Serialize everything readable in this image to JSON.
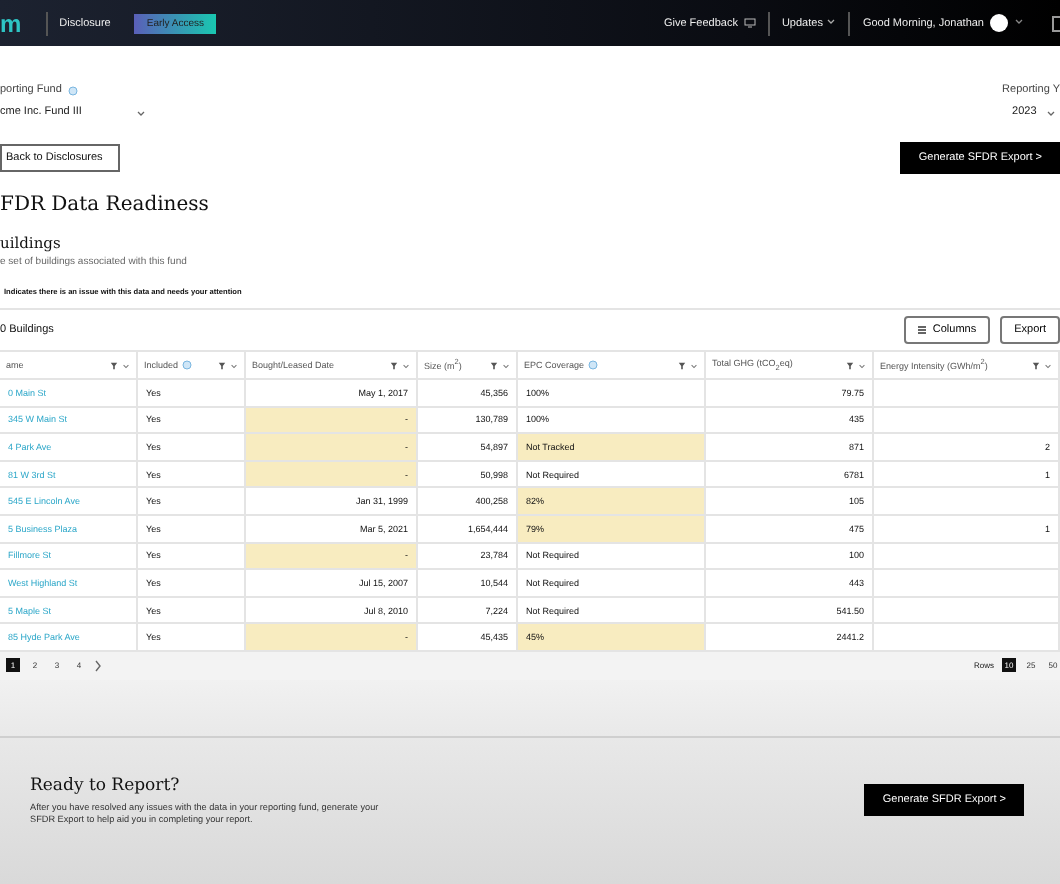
{
  "topbar": {
    "logo": "m",
    "section": "Disclosure",
    "badge": "Early Access",
    "feedback": "Give Feedback",
    "updates": "Updates",
    "greeting": "Good Morning, Jonathan"
  },
  "filters": {
    "fund_label": "porting Fund",
    "fund_value": "cme Inc. Fund III",
    "year_label": "Reporting Y",
    "year_value": "2023"
  },
  "back_button": "Back to Disclosures",
  "export_button": "Generate SFDR Export >",
  "title": "FDR Data Readiness",
  "section_title": "uildings",
  "section_subtitle": "e set of buildings associated with this fund",
  "notice": "Indicates there is an issue with this data and needs your attention",
  "table": {
    "count": "0 Buildings",
    "columns_button": "Columns",
    "export_button": "Export",
    "columns": [
      {
        "label": "ame",
        "info": false,
        "kind": "text"
      },
      {
        "label": "Included",
        "info": true,
        "kind": "text"
      },
      {
        "label": "Bought/Leased Date",
        "info": false,
        "kind": "number"
      },
      {
        "label": "Size (m$^{2}$)",
        "info": false,
        "kind": "number"
      },
      {
        "label": "EPC Coverage",
        "info": true,
        "kind": "text"
      },
      {
        "label": "Total GHG (tCO$_{2}$eq)",
        "info": false,
        "kind": "number"
      },
      {
        "label": "Energy Intensity (GWh/m$^{2}$)",
        "info": false,
        "kind": "number"
      }
    ],
    "rows": [
      {
        "cells": [
          {
            "text": "0 Main St",
            "flagged": false
          },
          {
            "text": "Yes",
            "flagged": false
          },
          {
            "text": "May 1, 2017",
            "flagged": false
          },
          {
            "text": "45,356",
            "flagged": false
          },
          {
            "text": "100%",
            "flagged": false
          },
          {
            "text": "79.75",
            "flagged": false
          },
          {
            "text": "",
            "flagged": false
          }
        ]
      },
      {
        "cells": [
          {
            "text": "345 W Main St",
            "flagged": false
          },
          {
            "text": "Yes",
            "flagged": false
          },
          {
            "text": "-",
            "flagged": true
          },
          {
            "text": "130,789",
            "flagged": false
          },
          {
            "text": "100%",
            "flagged": false
          },
          {
            "text": "435",
            "flagged": false
          },
          {
            "text": "",
            "flagged": false
          }
        ]
      },
      {
        "cells": [
          {
            "text": "4 Park Ave",
            "flagged": false
          },
          {
            "text": "Yes",
            "flagged": false
          },
          {
            "text": "-",
            "flagged": true
          },
          {
            "text": "54,897",
            "flagged": false
          },
          {
            "text": "Not Tracked",
            "flagged": true
          },
          {
            "text": "871",
            "flagged": false
          },
          {
            "text": "2",
            "flagged": false
          }
        ]
      },
      {
        "cells": [
          {
            "text": "81 W 3rd St",
            "flagged": false
          },
          {
            "text": "Yes",
            "flagged": false
          },
          {
            "text": "-",
            "flagged": true
          },
          {
            "text": "50,998",
            "flagged": false
          },
          {
            "text": "Not Required",
            "flagged": false
          },
          {
            "text": "6781",
            "flagged": false
          },
          {
            "text": "1",
            "flagged": false
          }
        ]
      },
      {
        "cells": [
          {
            "text": "545 E Lincoln Ave",
            "flagged": false
          },
          {
            "text": "Yes",
            "flagged": false
          },
          {
            "text": "Jan 31, 1999",
            "flagged": false
          },
          {
            "text": "400,258",
            "flagged": false
          },
          {
            "text": "82%",
            "flagged": true
          },
          {
            "text": "105",
            "flagged": false
          },
          {
            "text": "",
            "flagged": false
          }
        ]
      },
      {
        "cells": [
          {
            "text": "5 Business Plaza",
            "flagged": false
          },
          {
            "text": "Yes",
            "flagged": false
          },
          {
            "text": "Mar 5, 2021",
            "flagged": false
          },
          {
            "text": "1,654,444",
            "flagged": false
          },
          {
            "text": "79%",
            "flagged": true
          },
          {
            "text": "475",
            "flagged": false
          },
          {
            "text": "1",
            "flagged": false
          }
        ]
      },
      {
        "cells": [
          {
            "text": "Fillmore St",
            "flagged": false
          },
          {
            "text": "Yes",
            "flagged": false
          },
          {
            "text": "-",
            "flagged": true
          },
          {
            "text": "23,784",
            "flagged": false
          },
          {
            "text": "Not Required",
            "flagged": false
          },
          {
            "text": "100",
            "flagged": false
          },
          {
            "text": "",
            "flagged": false
          }
        ]
      },
      {
        "cells": [
          {
            "text": "West Highland St",
            "flagged": false
          },
          {
            "text": "Yes",
            "flagged": false
          },
          {
            "text": "Jul 15, 2007",
            "flagged": false
          },
          {
            "text": "10,544",
            "flagged": false
          },
          {
            "text": "Not Required",
            "flagged": false
          },
          {
            "text": "443",
            "flagged": false
          },
          {
            "text": "",
            "flagged": false
          }
        ]
      },
      {
        "cells": [
          {
            "text": "5 Maple St",
            "flagged": false
          },
          {
            "text": "Yes",
            "flagged": false
          },
          {
            "text": "Jul 8, 2010",
            "flagged": false
          },
          {
            "text": "7,224",
            "flagged": false
          },
          {
            "text": "Not Required",
            "flagged": false
          },
          {
            "text": "541.50",
            "flagged": false
          },
          {
            "text": "",
            "flagged": false
          }
        ]
      },
      {
        "cells": [
          {
            "text": "85 Hyde Park Ave",
            "flagged": false
          },
          {
            "text": "Yes",
            "flagged": false
          },
          {
            "text": "-",
            "flagged": true
          },
          {
            "text": "45,435",
            "flagged": false
          },
          {
            "text": "45%",
            "flagged": true
          },
          {
            "text": "2441.2",
            "flagged": false
          },
          {
            "text": "",
            "flagged": false
          }
        ]
      }
    ],
    "pages": [
      {
        "label": "1",
        "selected": true
      },
      {
        "label": "2",
        "selected": false
      },
      {
        "label": "3",
        "selected": false
      },
      {
        "label": "4",
        "selected": false
      }
    ],
    "rows_label": "Rows",
    "page_sizes": [
      {
        "label": "10",
        "selected": true
      },
      {
        "label": "25",
        "selected": false
      },
      {
        "label": "50",
        "selected": false
      }
    ]
  },
  "footer": {
    "title": "Ready to Report?",
    "text": "After you have resolved any issues with the data in your reporting fund, generate your SFDR Export to help aid you in completing your report.",
    "button": "Generate SFDR Export >"
  }
}
